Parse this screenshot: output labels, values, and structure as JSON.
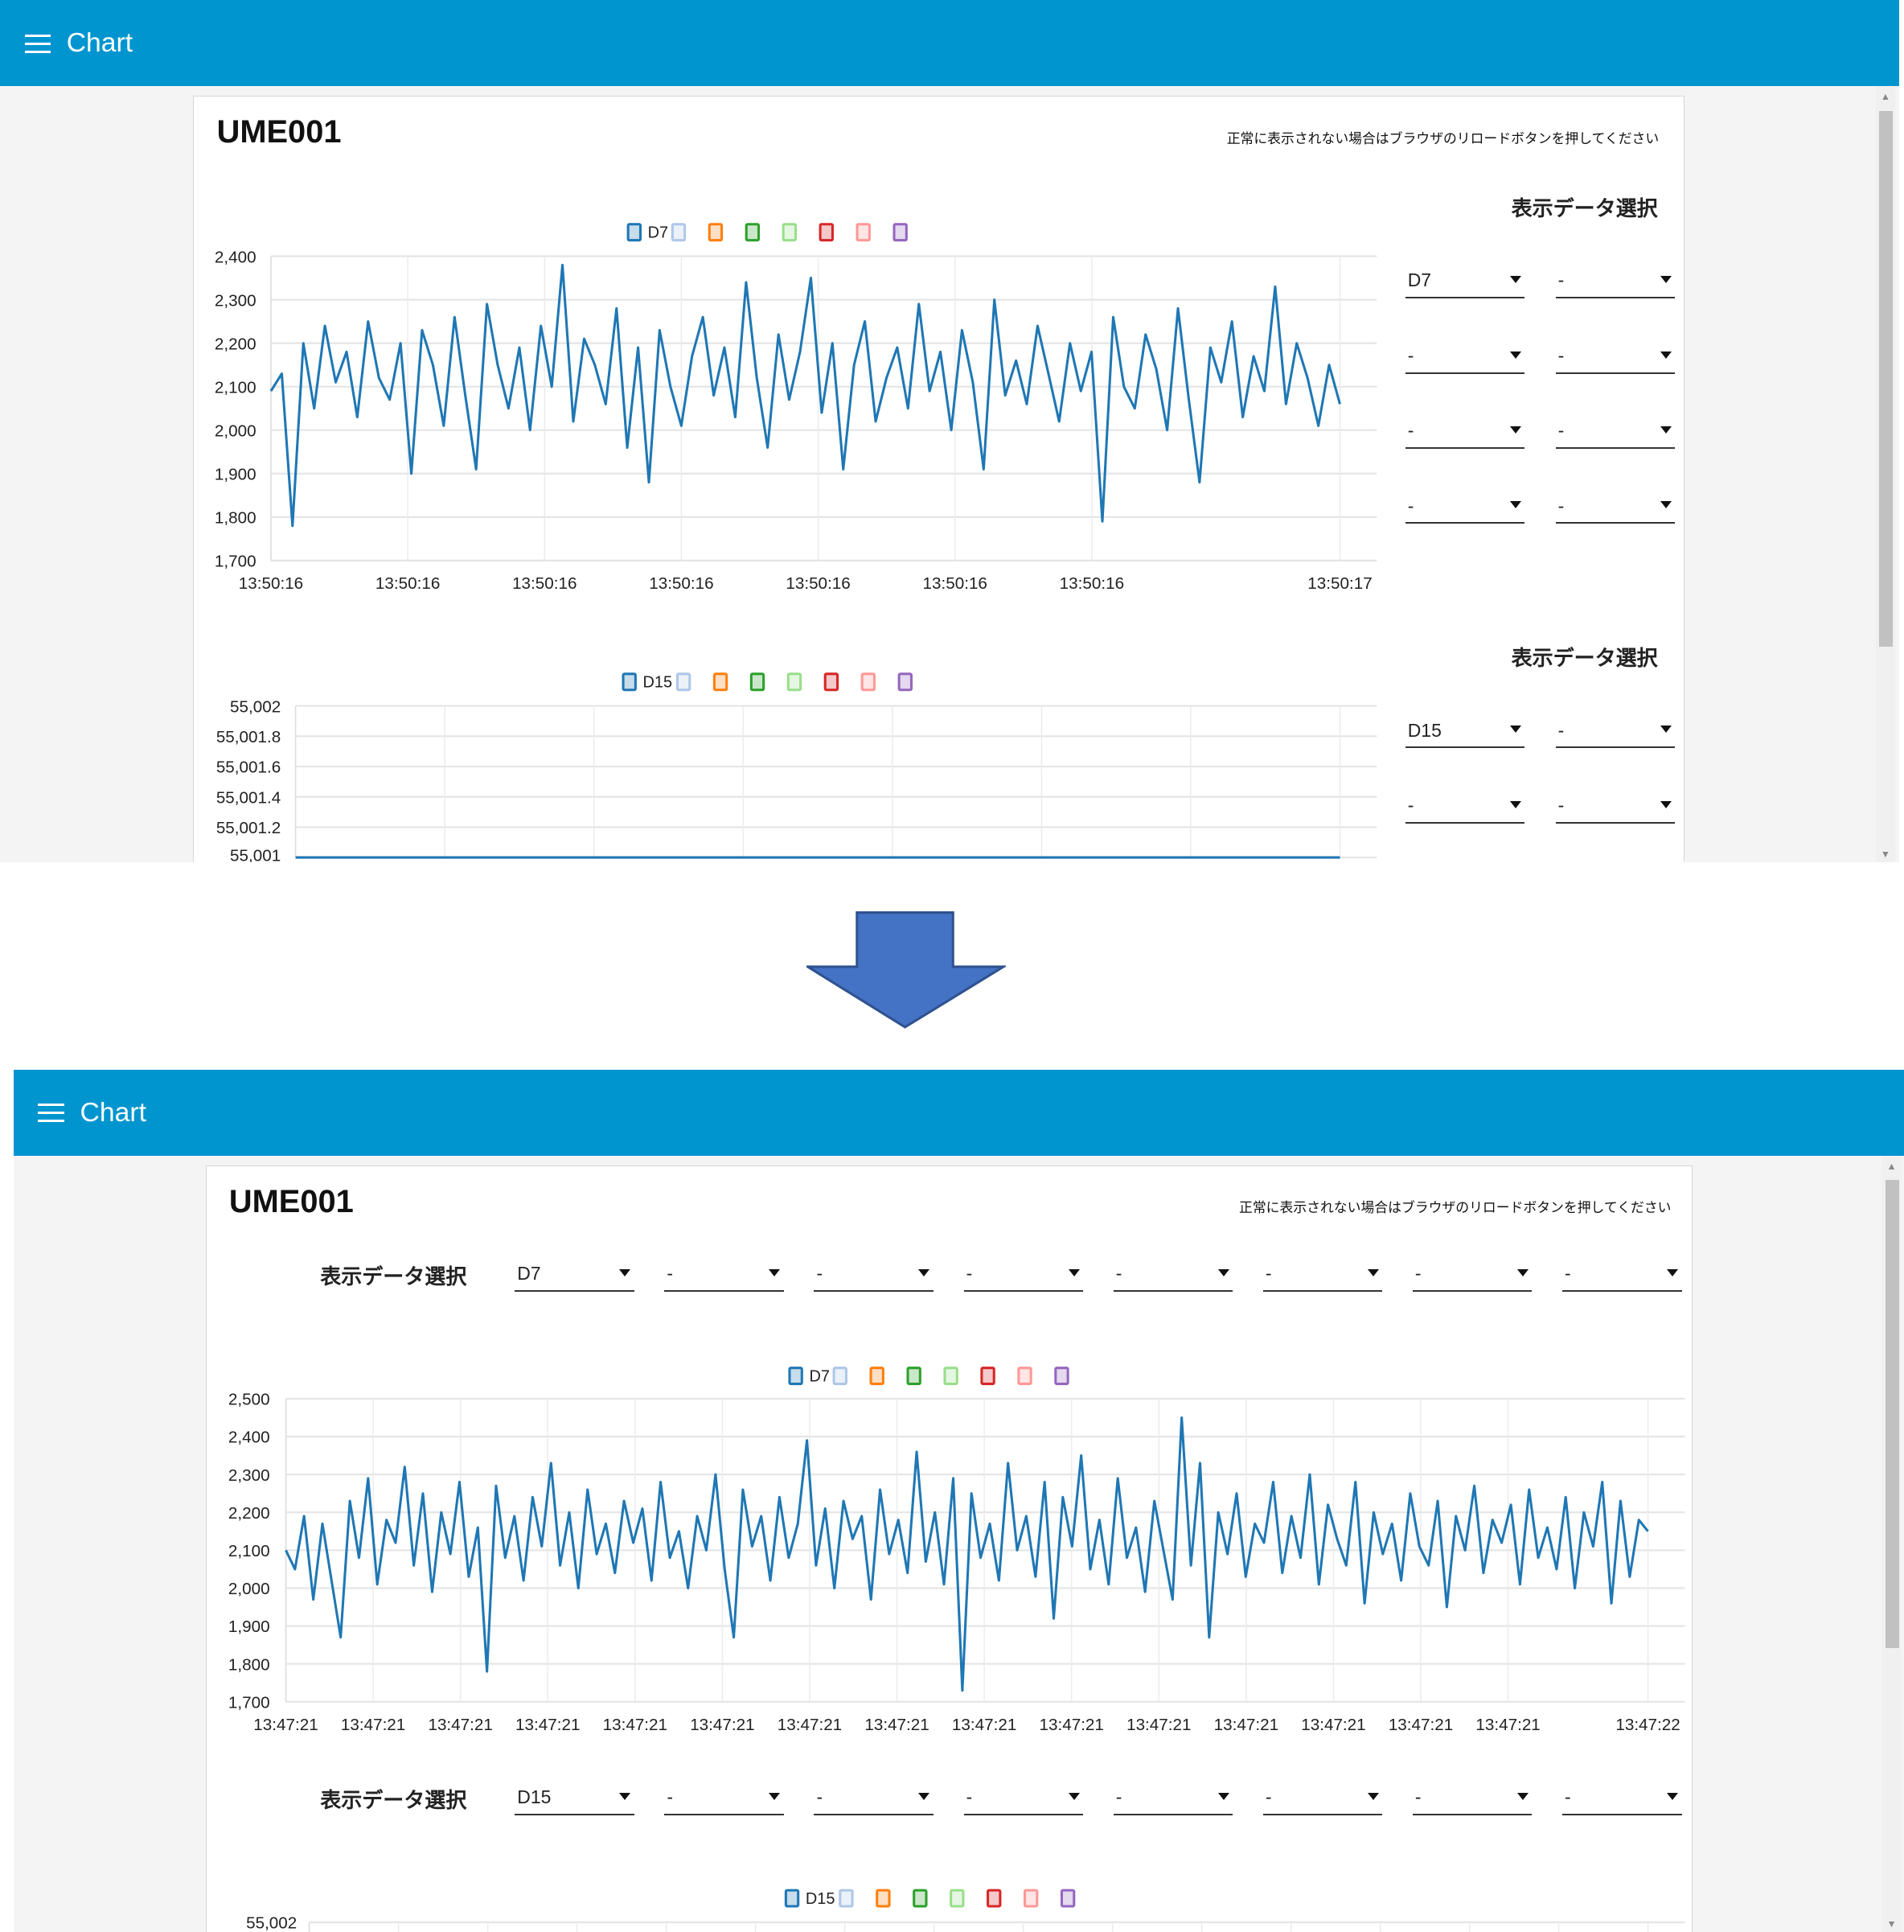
{
  "views": [
    {
      "appbar": {
        "title": "Chart",
        "menu_icon": "hamburger-icon"
      },
      "card": {
        "title": "UME001",
        "notice": "正常に表示されない場合はブラウザのリロードボタンを押してください"
      },
      "sections": [
        {
          "select_label": "表示データ選択",
          "selects": [
            "D7",
            "-",
            "-",
            "-",
            "-",
            "-",
            "-",
            "-"
          ]
        },
        {
          "select_label": "表示データ選択",
          "selects": [
            "D15",
            "-",
            "-",
            "-"
          ]
        }
      ]
    },
    {
      "appbar": {
        "title": "Chart",
        "menu_icon": "hamburger-icon"
      },
      "card": {
        "title": "UME001",
        "notice": "正常に表示されない場合はブラウザのリロードボタンを押してください"
      },
      "sections": [
        {
          "select_label": "表示データ選択",
          "selects": [
            "D7",
            "-",
            "-",
            "-",
            "-",
            "-",
            "-",
            "-"
          ]
        },
        {
          "select_label": "表示データ選択",
          "selects": [
            "D15",
            "-",
            "-",
            "-",
            "-",
            "-",
            "-",
            "-"
          ]
        }
      ]
    }
  ],
  "arrow": {
    "icon": "down-arrow-icon",
    "color": "#4472c4"
  },
  "colors": {
    "appbar": "#0095cf",
    "legend": [
      "#1f77b4",
      "#aec7e8",
      "#ff7f0e",
      "#2ca02c",
      "#98df8a",
      "#d62728",
      "#ff9896",
      "#9467bd"
    ]
  },
  "chart_data": [
    {
      "type": "line",
      "legend": [
        "D7",
        "",
        "",
        "",
        "",
        "",
        "",
        ""
      ],
      "series": [
        {
          "name": "D7",
          "values": [
            2090,
            2130,
            1780,
            2200,
            2050,
            2240,
            2110,
            2180,
            2030,
            2250,
            2120,
            2070,
            2200,
            1900,
            2230,
            2150,
            2010,
            2260,
            2080,
            1910,
            2290,
            2150,
            2050,
            2190,
            2000,
            2240,
            2100,
            2380,
            2020,
            2210,
            2150,
            2060,
            2280,
            1960,
            2190,
            1880,
            2230,
            2100,
            2010,
            2170,
            2260,
            2080,
            2190,
            2030,
            2340,
            2120,
            1960,
            2220,
            2070,
            2180,
            2350,
            2040,
            2200,
            1910,
            2150,
            2250,
            2020,
            2120,
            2190,
            2050,
            2290,
            2090,
            2180,
            2000,
            2230,
            2110,
            1910,
            2300,
            2080,
            2160,
            2060,
            2240,
            2130,
            2020,
            2200,
            2090,
            2180,
            1790,
            2260,
            2100,
            2050,
            2220,
            2140,
            2000,
            2280,
            2070,
            1880,
            2190,
            2110,
            2250,
            2030,
            2170,
            2090,
            2330,
            2060,
            2200,
            2120,
            2010,
            2150,
            2060
          ]
        }
      ],
      "ylim": [
        1700,
        2400
      ],
      "y_ticks": [
        1700,
        1800,
        1900,
        2000,
        2100,
        2200,
        2300,
        2400
      ],
      "y_tick_labels": [
        "1,700",
        "1,800",
        "1,900",
        "2,000",
        "2,100",
        "2,200",
        "2,300",
        "2,400"
      ],
      "x_ticks": [
        {
          "label": "13:50:16",
          "at": 0
        },
        {
          "label": "13:50:16",
          "at": 12.67
        },
        {
          "label": "13:50:16",
          "at": 25.34
        },
        {
          "label": "13:50:16",
          "at": 38.01
        },
        {
          "label": "13:50:16",
          "at": 50.68
        },
        {
          "label": "13:50:16",
          "at": 63.35
        },
        {
          "label": "13:50:16",
          "at": 76.02
        },
        {
          "label": "13:50:17",
          "at": 99
        }
      ],
      "grid": true,
      "legend_position": "top"
    },
    {
      "type": "line",
      "legend": [
        "D15",
        "",
        "",
        "",
        "",
        "",
        "",
        ""
      ],
      "series": [
        {
          "name": "D15",
          "values": [
            55001,
            55001
          ]
        }
      ],
      "ylim": [
        55001,
        55002
      ],
      "y_ticks": [
        55001,
        55001.2,
        55001.4,
        55001.6,
        55001.8,
        55002
      ],
      "y_tick_labels": [
        "55,001",
        "55,001.2",
        "55,001.4",
        "55,001.6",
        "55,001.8",
        "55,002"
      ],
      "x_ticks": [],
      "grid": true,
      "legend_position": "top"
    },
    {
      "type": "line",
      "legend": [
        "D7",
        "",
        "",
        "",
        "",
        "",
        "",
        ""
      ],
      "series": [
        {
          "name": "D7",
          "values": [
            2100,
            2050,
            2190,
            1970,
            2170,
            2020,
            1870,
            2230,
            2080,
            2290,
            2010,
            2180,
            2120,
            2320,
            2060,
            2250,
            1990,
            2200,
            2090,
            2280,
            2030,
            2160,
            1780,
            2270,
            2080,
            2190,
            2020,
            2240,
            2110,
            2330,
            2060,
            2200,
            2000,
            2260,
            2090,
            2170,
            2040,
            2230,
            2120,
            2210,
            2020,
            2280,
            2080,
            2150,
            2000,
            2190,
            2100,
            2300,
            2050,
            1870,
            2260,
            2110,
            2190,
            2020,
            2240,
            2080,
            2170,
            2390,
            2060,
            2210,
            2000,
            2230,
            2130,
            2190,
            1970,
            2260,
            2090,
            2180,
            2040,
            2360,
            2070,
            2200,
            2010,
            2290,
            1730,
            2250,
            2080,
            2170,
            2020,
            2330,
            2100,
            2190,
            2030,
            2280,
            1920,
            2240,
            2110,
            2350,
            2050,
            2180,
            2010,
            2290,
            2080,
            2160,
            1990,
            2230,
            2100,
            1970,
            2450,
            2060,
            2330,
            1870,
            2200,
            2090,
            2250,
            2030,
            2170,
            2120,
            2280,
            2040,
            2190,
            2080,
            2300,
            2010,
            2220,
            2130,
            2060,
            2280,
            1960,
            2200,
            2090,
            2170,
            2020,
            2250,
            2110,
            2060,
            2230,
            1950,
            2190,
            2100,
            2270,
            2040,
            2180,
            2120,
            2220,
            2010,
            2260,
            2080,
            2160,
            2050,
            2240,
            2000,
            2200,
            2110,
            2280,
            1960,
            2230,
            2030,
            2180,
            2150
          ]
        }
      ],
      "ylim": [
        1700,
        2500
      ],
      "y_ticks": [
        1700,
        1800,
        1900,
        2000,
        2100,
        2200,
        2300,
        2400,
        2500
      ],
      "y_tick_labels": [
        "1,700",
        "1,800",
        "1,900",
        "2,000",
        "2,100",
        "2,200",
        "2,300",
        "2,400",
        "2,500"
      ],
      "x_ticks": [
        {
          "label": "13:47:21",
          "at": 0
        },
        {
          "label": "13:47:21",
          "at": 9.55
        },
        {
          "label": "13:47:21",
          "at": 19.1
        },
        {
          "label": "13:47:21",
          "at": 28.65
        },
        {
          "label": "13:47:21",
          "at": 38.2
        },
        {
          "label": "13:47:21",
          "at": 47.75
        },
        {
          "label": "13:47:21",
          "at": 57.3
        },
        {
          "label": "13:47:21",
          "at": 66.85
        },
        {
          "label": "13:47:21",
          "at": 76.4
        },
        {
          "label": "13:47:21",
          "at": 85.95
        },
        {
          "label": "13:47:21",
          "at": 95.5
        },
        {
          "label": "13:47:21",
          "at": 105.05
        },
        {
          "label": "13:47:21",
          "at": 114.6
        },
        {
          "label": "13:47:21",
          "at": 124.15
        },
        {
          "label": "13:47:21",
          "at": 133.7
        },
        {
          "label": "13:47:22",
          "at": 149
        }
      ],
      "grid": true,
      "legend_position": "top"
    },
    {
      "type": "line",
      "legend": [
        "D15",
        "",
        "",
        "",
        "",
        "",
        "",
        ""
      ],
      "series": [
        {
          "name": "D15",
          "values": []
        }
      ],
      "ylim": [
        55001,
        55002
      ],
      "y_ticks": [
        55002
      ],
      "y_tick_labels": [
        "55,002"
      ],
      "x_ticks": [],
      "grid": true,
      "legend_position": "top"
    }
  ]
}
